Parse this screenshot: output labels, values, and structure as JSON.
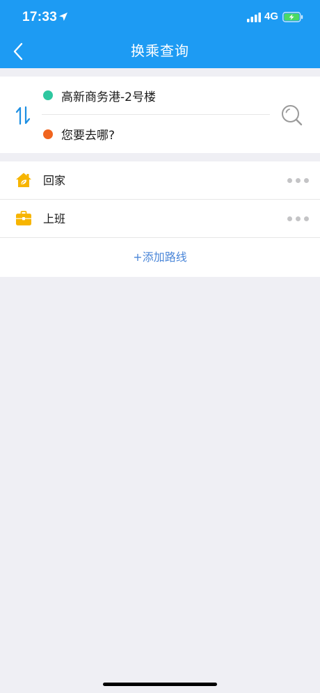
{
  "status_bar": {
    "time": "17:33",
    "network": "4G",
    "icons": [
      "location-arrow-icon",
      "signal-icon",
      "battery-charging-icon"
    ]
  },
  "nav": {
    "title": "换乘查询",
    "back_icon": "chevron-left-icon"
  },
  "route": {
    "from": "高新商务港-2号楼",
    "to": "您要去哪?",
    "from_color": "#2ec7a0",
    "to_color": "#f0641e",
    "swap_icon": "swap-vertical-icon",
    "search_icon": "search-icon"
  },
  "saved_routes": [
    {
      "label": "回家",
      "icon": "home-icon"
    },
    {
      "label": "上班",
      "icon": "briefcase-icon"
    }
  ],
  "add_route_label": "+添加路线",
  "colors": {
    "header": "#1d9bf3",
    "background": "#efeff4",
    "accent_link": "#4a86d8",
    "icon_yellow": "#f7b500"
  }
}
